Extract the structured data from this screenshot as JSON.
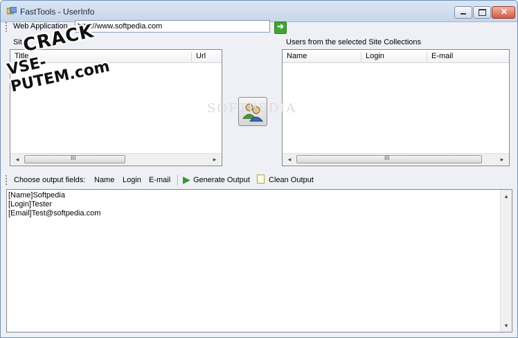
{
  "window": {
    "title": "FastTools - UserInfo"
  },
  "toolbar": {
    "web_app_label": "Web Application",
    "url_value": "http://www.softpedia.com"
  },
  "sites": {
    "group_label": "Site",
    "columns": [
      "Title",
      "Url"
    ]
  },
  "users": {
    "group_label": "Users from the selected Site Collections",
    "columns": [
      "Name",
      "Login",
      "E-mail"
    ]
  },
  "scrollbar": {
    "grip": "III",
    "left": "◂",
    "right": "▸"
  },
  "output_toolbar": {
    "choose_label": "Choose output fields:",
    "fields": [
      "Name",
      "Login",
      "E-mail"
    ],
    "generate_label": "Generate Output",
    "clean_label": "Clean Output"
  },
  "output": {
    "lines": [
      "[Name]Softpedia",
      "[Login]Tester",
      "[Email]Test@softpedia.com"
    ]
  },
  "watermark": {
    "line1": "CRACK",
    "line2": "VSE-PUTEM.com",
    "softpedia": "SOFTPEDIA"
  },
  "colors": {
    "go_button": "#3fa531",
    "title_bar": "#c7d6ea",
    "close_button": "#d35a40"
  }
}
